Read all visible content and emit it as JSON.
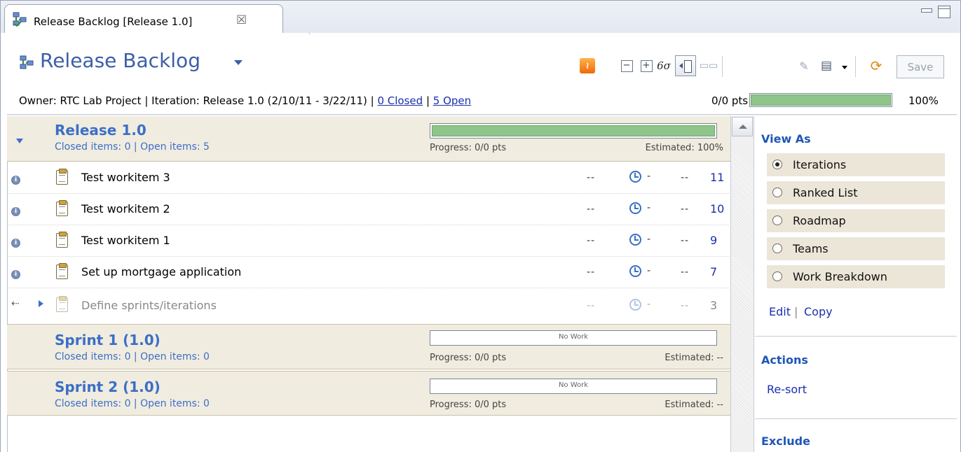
{
  "tab": {
    "label": "Release Backlog [Release 1.0]",
    "close_glyph": "☒"
  },
  "header": {
    "title": "Release Backlog",
    "save_label": "Save",
    "owner_text": "Owner: RTC Lab Project | Iteration: Release 1.0 (2/10/11 - 3/22/11) | ",
    "closed_link": "0 Closed",
    "separator": " | ",
    "open_link": "5 Open",
    "points_label": "0/0 pts",
    "percent_label": "100%",
    "progress_fraction": 1.0
  },
  "toolbar": {
    "rss_glyph": ")",
    "collapse_glyph": "−",
    "expand_glyph": "+",
    "glasses_glyph": "6σ",
    "grid_glyph": "▭▭",
    "edit_glyph": "✎",
    "newdoc_glyph": "▤",
    "refresh_glyph": "⟳"
  },
  "sections": [
    {
      "title": "Release 1.0",
      "subtitle": "Closed items: 0 | Open items: 5",
      "progress": "Progress: 0/0 pts",
      "estimated": "Estimated: 100%",
      "bar_text": "",
      "bar_fraction": 1.0
    },
    {
      "title": "Sprint 1 (1.0)",
      "subtitle": "Closed items: 0 | Open items: 0",
      "progress": "Progress: 0/0 pts",
      "estimated": "Estimated: --",
      "bar_text": "No Work",
      "bar_fraction": 0
    },
    {
      "title": "Sprint 2 (1.0)",
      "subtitle": "Closed items: 0 | Open items: 0",
      "progress": "Progress: 0/0 pts",
      "estimated": "Estimated: --",
      "bar_text": "No Work",
      "bar_fraction": 0
    }
  ],
  "items": [
    {
      "label": "Test workitem 3",
      "dash1": "--",
      "dash2": "-",
      "dash3": "--",
      "id": "11"
    },
    {
      "label": "Test workitem 2",
      "dash1": "--",
      "dash2": "-",
      "dash3": "--",
      "id": "10"
    },
    {
      "label": "Test workitem 1",
      "dash1": "--",
      "dash2": "-",
      "dash3": "--",
      "id": "9"
    },
    {
      "label": "Set up mortgage application",
      "dash1": "--",
      "dash2": "-",
      "dash3": "--",
      "id": "7"
    },
    {
      "label": "Define sprints/iterations",
      "dash1": "--",
      "dash2": "-",
      "dash3": "--",
      "id": "3"
    }
  ],
  "side": {
    "view_as_title": "View As",
    "options": [
      "Iterations",
      "Ranked List",
      "Roadmap",
      "Teams",
      "Work Breakdown"
    ],
    "selected_option": "Iterations",
    "edit_link": "Edit",
    "copy_link": "Copy",
    "actions_title": "Actions",
    "resort_link": "Re-sort",
    "exclude_title": "Exclude"
  },
  "colors": {
    "accent": "#3b6fc7",
    "section_bg": "#f1ece0",
    "progress_fill": "#8fc48a",
    "link": "#1a2fb0"
  }
}
